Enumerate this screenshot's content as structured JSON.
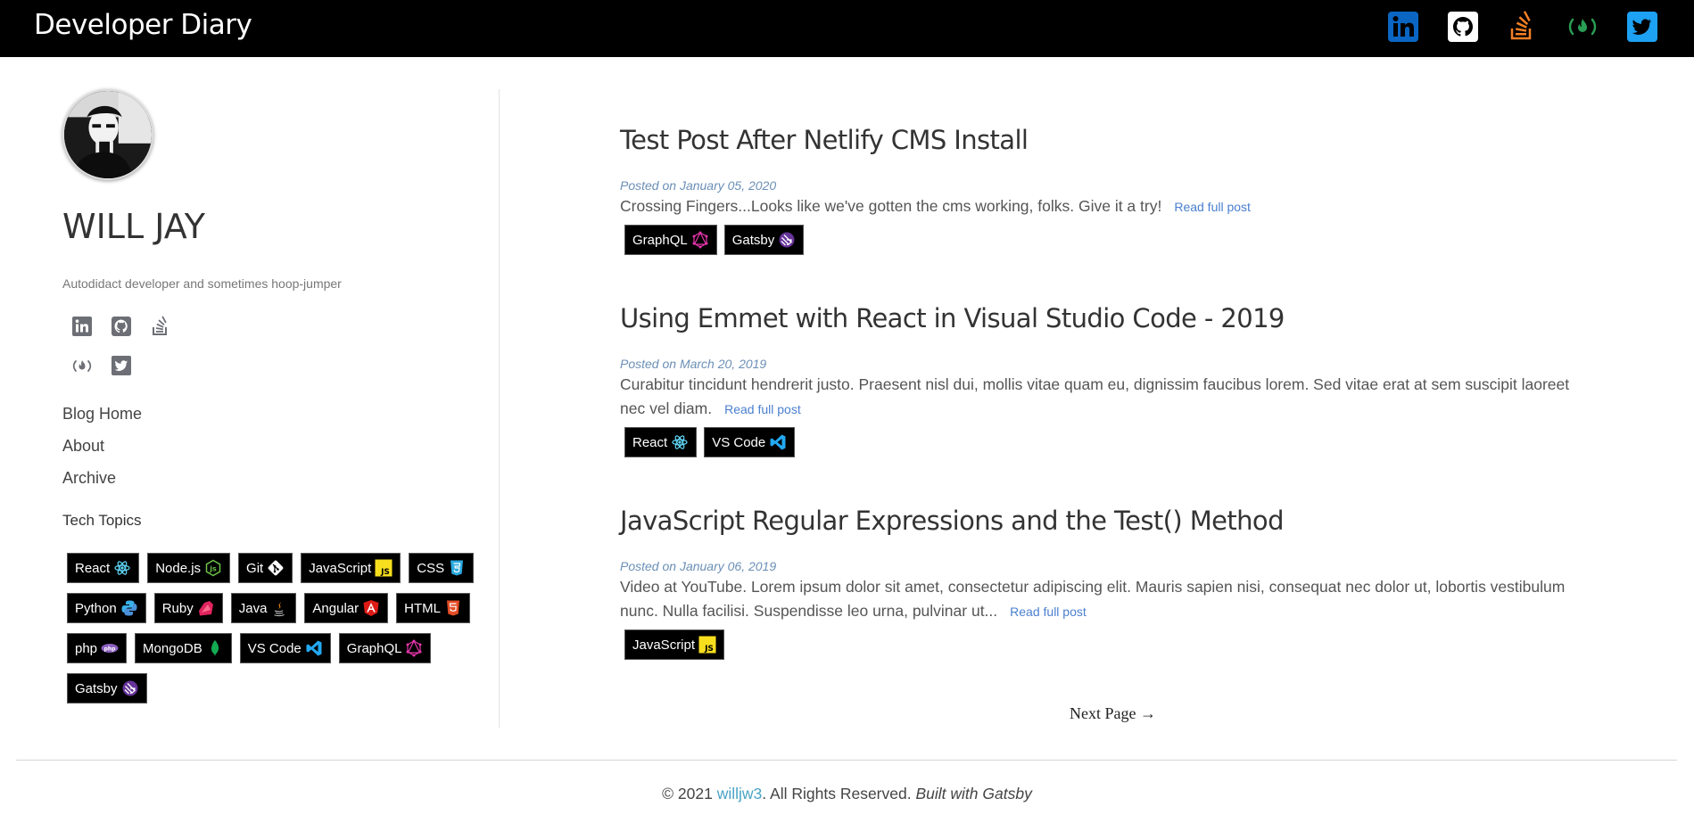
{
  "header": {
    "brand": "Developer Diary",
    "icons": [
      "linkedin-icon",
      "github-icon",
      "stackoverflow-icon",
      "freecodecamp-icon",
      "twitter-icon"
    ]
  },
  "profile": {
    "name": "WILL JAY",
    "tagline": "Autodidact developer and sometimes hoop-jumper"
  },
  "nav": {
    "items": [
      "Blog Home",
      "About",
      "Archive"
    ]
  },
  "topics": {
    "title": "Tech Topics",
    "tags": [
      "React",
      "Node.js",
      "Git",
      "JavaScript",
      "CSS",
      "Python",
      "Ruby",
      "Java",
      "Angular",
      "HTML",
      "php",
      "MongoDB",
      "VS Code",
      "GraphQL",
      "Gatsby"
    ]
  },
  "posts": [
    {
      "title": "Test Post After Netlify CMS Install",
      "date": "Posted on January 05, 2020",
      "excerpt": "Crossing Fingers...Looks like we've gotten the cms working, folks. Give it a try!",
      "read_more": "Read full post",
      "tags": [
        "GraphQL",
        "Gatsby"
      ]
    },
    {
      "title": "Using Emmet with React in Visual Studio Code - 2019",
      "date": "Posted on March 20, 2019",
      "excerpt": "Curabitur tincidunt hendrerit justo. Praesent nisl dui, mollis vitae quam eu, dignissim faucibus lorem. Sed vitae erat at sem suscipit laoreet nec vel diam.",
      "read_more": "Read full post",
      "tags": [
        "React",
        "VS Code"
      ]
    },
    {
      "title": "JavaScript Regular Expressions and the Test() Method",
      "date": "Posted on January 06, 2019",
      "excerpt": "Video at YouTube. Lorem ipsum dolor sit amet, consectetur adipiscing elit. Mauris sapien nisi, consequat nec dolor ut, lobortis vestibulum nunc. Nulla facilisi. Suspendisse leo urna, pulvinar ut...",
      "read_more": "Read full post",
      "tags": [
        "JavaScript"
      ]
    }
  ],
  "pagination": {
    "next": "Next Page →"
  },
  "footer": {
    "copyright": "© 2021",
    "author_link": "willjw3",
    "rights": ". All Rights Reserved.",
    "built_with": "Built with",
    "built_link": "Gatsby"
  },
  "colors": {
    "link": "#4a7fcf",
    "date": "#6b8fb6",
    "footer_link": "#4aa3c6",
    "linkedin": "#0a66c2",
    "stackoverflow": "#f48024",
    "freecodecamp": "#2a9d54",
    "twitter": "#1da1f2"
  }
}
